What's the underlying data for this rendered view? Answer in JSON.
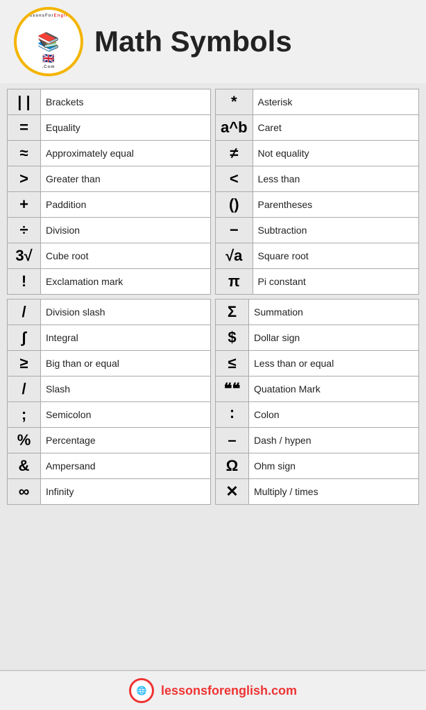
{
  "header": {
    "title": "Math Symbols",
    "logo_arc_top": "LessonsForEnglish",
    "logo_arc_bottom": ".Com"
  },
  "table1_top": [
    {
      "symbol": "| |",
      "name": "Brackets"
    },
    {
      "symbol": "=",
      "name": "Equality"
    },
    {
      "symbol": "≈",
      "name": "Approximately equal"
    },
    {
      "symbol": ">",
      "name": "Greater than"
    },
    {
      "symbol": "+",
      "name": "Paddition"
    },
    {
      "symbol": "÷",
      "name": "Division"
    },
    {
      "symbol": "3√",
      "name": "Cube root"
    },
    {
      "symbol": "!",
      "name": "Exclamation mark"
    }
  ],
  "table2_top": [
    {
      "symbol": "*",
      "name": "Asterisk"
    },
    {
      "symbol": "a^b",
      "name": "Caret"
    },
    {
      "symbol": "≠",
      "name": "Not equality"
    },
    {
      "symbol": "<",
      "name": "Less than"
    },
    {
      "symbol": "()",
      "name": "Parentheses"
    },
    {
      "symbol": "−",
      "name": "Subtraction"
    },
    {
      "symbol": "√a",
      "name": "Square root"
    },
    {
      "symbol": "π",
      "name": "Pi constant"
    }
  ],
  "table1_bottom": [
    {
      "symbol": "/",
      "name": "Division slash"
    },
    {
      "symbol": "∫",
      "name": "Integral"
    },
    {
      "symbol": "≥",
      "name": "Big than or equal"
    },
    {
      "symbol": "/",
      "name": "Slash"
    },
    {
      "symbol": ";",
      "name": "Semicolon"
    },
    {
      "symbol": "%",
      "name": "Percentage"
    },
    {
      "symbol": "&",
      "name": "Ampersand"
    },
    {
      "symbol": "∞",
      "name": "Infinity"
    }
  ],
  "table2_bottom": [
    {
      "symbol": "Σ",
      "name": "Summation"
    },
    {
      "symbol": "$",
      "name": "Dollar sign"
    },
    {
      "symbol": "≤",
      "name": "Less than or equal"
    },
    {
      "symbol": "❝❝",
      "name": "Quatation Mark"
    },
    {
      "symbol": "∶",
      "name": "Colon"
    },
    {
      "symbol": "–",
      "name": "Dash / hypen"
    },
    {
      "symbol": "Ω",
      "name": "Ohm sign"
    },
    {
      "symbol": "✕",
      "name": "Multiply / times"
    }
  ],
  "footer": {
    "url": "lessonsforenglish.com"
  }
}
